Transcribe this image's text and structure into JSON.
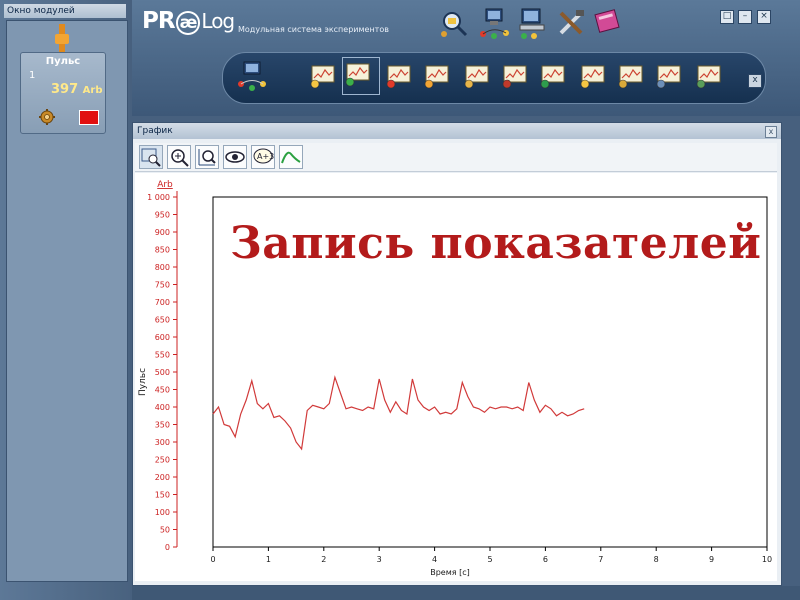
{
  "modules_window": {
    "title": "Окно модулей",
    "module": {
      "name": "Пульс",
      "channel": "1",
      "value": "397",
      "unit": "Arb"
    }
  },
  "header": {
    "logo_pr": "PR",
    "logo_ae": "æ",
    "logo_log": "Log",
    "subtitle": "Модульная система экспериментов",
    "top_icons": [
      "search-settings-icon",
      "network-computer-icon",
      "computer-probe-icon",
      "tools-icon",
      "help-book-icon"
    ],
    "window_buttons": [
      "restore",
      "minimize",
      "close"
    ],
    "toolbar_icons": [
      "network-computer-icon",
      "graph-settings-icon",
      "graph-running-icon",
      "graph-thermometer-icon",
      "graph-probe-icon",
      "open-folder-icon",
      "save-disk-icon",
      "excel-export-icon",
      "graph-eraser-icon",
      "lock-icon",
      "printer-icon",
      "computer-icon"
    ],
    "toolbar_close": "x"
  },
  "graph_window": {
    "title": "График",
    "close": "x",
    "tools": [
      "cursor-zoom-icon",
      "zoom-in-icon",
      "zoom-axes-icon",
      "eye-icon",
      "annotation-icon",
      "curve-fit-icon"
    ]
  },
  "overlay_text": "Запись показателей",
  "chart_data": {
    "type": "line",
    "title": "",
    "xlabel": "Время [с]",
    "ylabel": "Пульс",
    "yunit": "Arb",
    "xlim": [
      0,
      10
    ],
    "ylim": [
      0,
      1000
    ],
    "xticks": [
      0,
      1,
      2,
      3,
      4,
      5,
      6,
      7,
      8,
      9,
      10
    ],
    "yticks": [
      0,
      50,
      100,
      150,
      200,
      250,
      300,
      350,
      400,
      450,
      500,
      550,
      600,
      650,
      700,
      750,
      800,
      850,
      900,
      950,
      1000
    ],
    "ytick_labels": [
      "0",
      "50",
      "100",
      "150",
      "200",
      "250",
      "300",
      "350",
      "400",
      "450",
      "500",
      "550",
      "600",
      "650",
      "700",
      "750",
      "800",
      "850",
      "900",
      "950",
      "1 000"
    ],
    "grid": false,
    "colors": {
      "line": "#d13a3a",
      "axis_text": "#cc2222"
    },
    "series": [
      {
        "x": [
          0,
          0.1,
          0.2,
          0.3,
          0.4,
          0.5,
          0.6,
          0.7,
          0.8,
          0.9,
          1.0,
          1.1,
          1.2,
          1.3,
          1.4,
          1.5,
          1.6,
          1.7,
          1.8,
          1.9,
          2.0,
          2.1,
          2.2,
          2.3,
          2.4,
          2.5,
          2.6,
          2.7,
          2.8,
          2.9,
          3.0,
          3.1,
          3.2,
          3.3,
          3.4,
          3.5,
          3.6,
          3.7,
          3.8,
          3.9,
          4.0,
          4.1,
          4.2,
          4.3,
          4.4,
          4.5,
          4.6,
          4.7,
          4.8,
          4.9,
          5.0,
          5.1,
          5.2,
          5.3,
          5.4,
          5.5,
          5.6,
          5.7,
          5.8,
          5.9,
          6.0,
          6.1,
          6.2,
          6.3,
          6.4,
          6.5,
          6.6,
          6.7
        ],
        "values": [
          380,
          400,
          350,
          345,
          315,
          380,
          420,
          475,
          410,
          395,
          410,
          370,
          375,
          360,
          340,
          300,
          280,
          390,
          405,
          400,
          395,
          410,
          485,
          440,
          395,
          400,
          395,
          390,
          400,
          395,
          480,
          420,
          385,
          415,
          390,
          380,
          480,
          420,
          400,
          390,
          400,
          380,
          385,
          380,
          395,
          470,
          430,
          400,
          395,
          385,
          400,
          395,
          400,
          400,
          395,
          400,
          390,
          470,
          420,
          385,
          405,
          395,
          375,
          385,
          375,
          380,
          390,
          395
        ]
      }
    ]
  }
}
